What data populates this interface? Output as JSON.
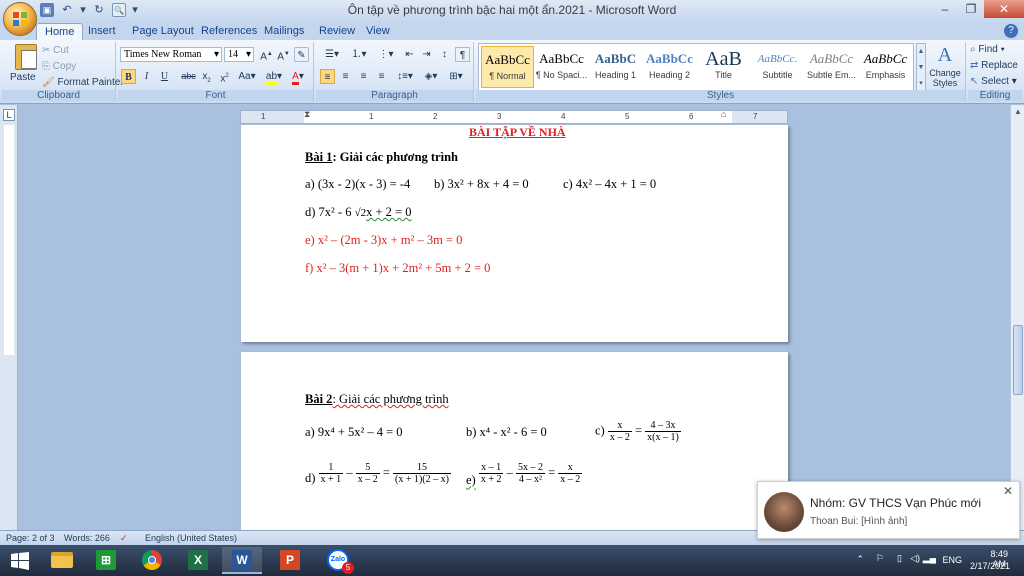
{
  "window": {
    "title": "Ôn tập về phương trình bậc hai một ẩn.2021 - Microsoft Word",
    "minimize": "–",
    "restore": "❐",
    "close": "✕"
  },
  "tabs": [
    "Home",
    "Insert",
    "Page Layout",
    "References",
    "Mailings",
    "Review",
    "View"
  ],
  "clipboard": {
    "paste": "Paste",
    "cut": "Cut",
    "copy": "Copy",
    "format_painter": "Format Painter",
    "label": "Clipboard"
  },
  "font": {
    "name": "Times New Roman",
    "size": "14",
    "label": "Font"
  },
  "paragraph": {
    "label": "Paragraph"
  },
  "styles": {
    "label": "Styles",
    "items": [
      {
        "sample": "AaBbCc",
        "name": "¶ Normal"
      },
      {
        "sample": "AaBbCc",
        "name": "¶ No Spaci..."
      },
      {
        "sample": "AaBbC",
        "name": "Heading 1"
      },
      {
        "sample": "AaBbCc",
        "name": "Heading 2"
      },
      {
        "sample": "AaB",
        "name": "Title"
      },
      {
        "sample": "AaBbCc.",
        "name": "Subtitle"
      },
      {
        "sample": "AaBbCc",
        "name": "Subtle Em..."
      },
      {
        "sample": "AaBbCc",
        "name": "Emphasis"
      }
    ],
    "change_styles": "Change Styles"
  },
  "editing": {
    "find": "Find",
    "replace": "Replace",
    "select": "Select",
    "label": "Editing"
  },
  "document": {
    "page1_heading": "BÀI TẬP VỀ NHÀ",
    "bai1_title": "Bài 1",
    "bai1_rest": ": Giải các phương trình",
    "bai1_a": "a) (3x - 2)(x - 3) = -4",
    "bai1_b": "b) 3x² + 8x + 4 = 0",
    "bai1_c": "c) 4x² – 4x + 1 = 0",
    "bai1_d_pre": "d) 7x² - 6",
    "bai1_d_sqrt": "√2",
    "bai1_d_post": "x + 2 = 0",
    "bai1_e": "e) x² – (2m - 3)x + m² – 3m = 0",
    "bai1_f": "f) x² – 3(m + 1)x + 2m² + 5m + 2 = 0",
    "bai2_title": "Bài 2",
    "bai2_rest": ": Giải các phương trình",
    "bai2_a": "a) 9x⁴ + 5x² – 4 = 0",
    "bai2_b": "b) x⁴ - x² - 6 = 0",
    "bai2_c_label": "c)",
    "bai2_c_n1": "x",
    "bai2_c_d1": "x – 2",
    "bai2_c_n2": "4 – 3x",
    "bai2_c_d2": "x(x – 1)",
    "bai2_d_label": "d)",
    "bai2_d_n1": "1",
    "bai2_d_d1": "x + 1",
    "bai2_d_n2": "5",
    "bai2_d_d2": "x – 2",
    "bai2_d_n3": "15",
    "bai2_d_d3": "(x + 1)(2 – x)",
    "bai2_e_label": "e)",
    "bai2_e_n1": "x – 1",
    "bai2_e_d1": "x + 2",
    "bai2_e_n2": "5x – 2",
    "bai2_e_d2": "4 – x²",
    "bai2_e_n3": "x",
    "bai2_e_d3": "x – 2",
    "ops": {
      "minus": "–",
      "equals": "="
    }
  },
  "status": {
    "page": "Page: 2 of 3",
    "words": "Words: 266",
    "language": "English (United States)"
  },
  "notification": {
    "title": "Nhóm: GV THCS Vạn Phúc mới",
    "body": "Thoan Bui: [Hình ảnh]",
    "close": "✕"
  },
  "tray": {
    "lang": "ENG",
    "time": "8:49 AM",
    "date": "2/17/2021"
  },
  "taskbar": {
    "zalo_badge": "5",
    "zalo_label": "Zalo"
  },
  "ruler_marks": [
    "1",
    "1",
    "2",
    "3",
    "4",
    "5",
    "6",
    "7"
  ]
}
